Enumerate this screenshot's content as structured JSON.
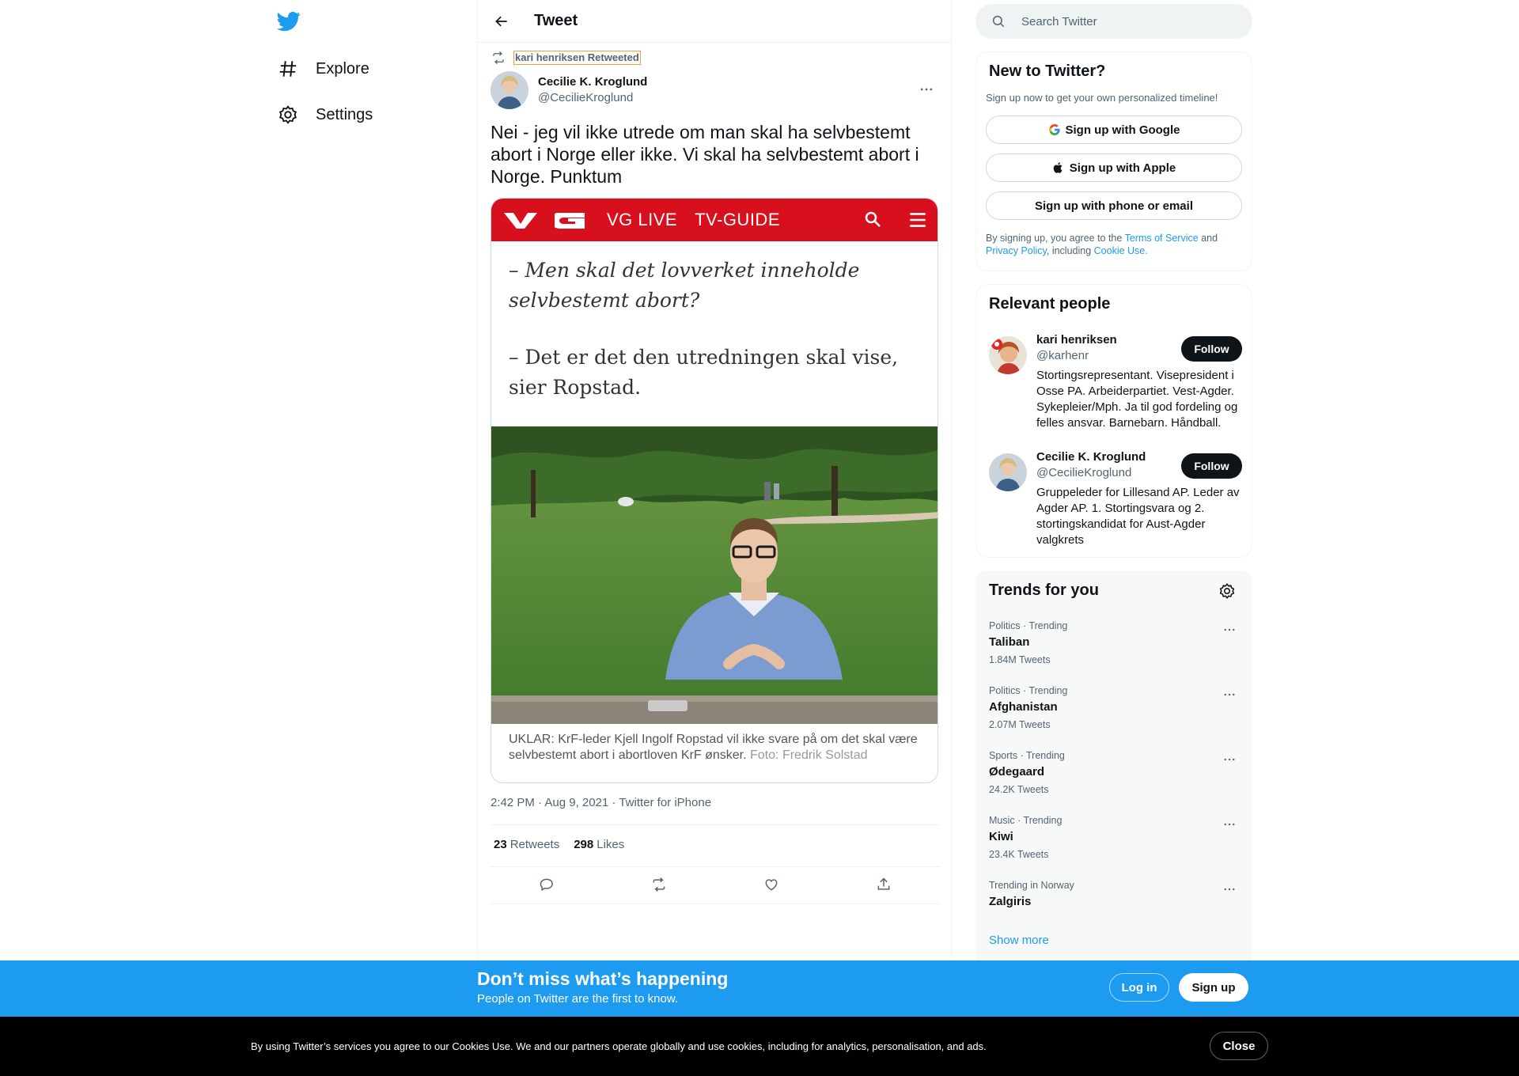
{
  "nav": {
    "logo": "twitter-bird-icon",
    "items": [
      {
        "icon": "hashtag-icon",
        "label": "Explore"
      },
      {
        "icon": "gear-icon",
        "label": "Settings"
      }
    ]
  },
  "header": {
    "title": "Tweet"
  },
  "tweet": {
    "retweeted_by": "kari henriksen Retweeted",
    "author_name": "Cecilie K. Kroglund",
    "author_handle": "@CecilieKroglund",
    "text": "Nei - jeg vil ikke utrede om man skal ha selvbestemt abort i Norge eller ikke. Vi skal ha selvbestemt abort i Norge. Punktum",
    "media": {
      "nav_links": [
        "VG LIVE",
        "TV-GUIDE"
      ],
      "quote_1": "– Men skal det lovverket inneholde selvbestemt abort?",
      "quote_2": "– Det er det den utredningen skal vise, sier Ropstad.",
      "caption": "UKLAR: KrF-leder Kjell Ingolf Ropstad vil ikke svare på om det skal være selvbestemt abort i abortloven KrF ønsker.",
      "caption_credit": "Foto: Fredrik Solstad"
    },
    "meta": "2:42 PM · Aug 9, 2021 · Twitter for iPhone",
    "retweets_count": "23",
    "retweets_label": "Retweets",
    "likes_count": "298",
    "likes_label": "Likes"
  },
  "search": {
    "placeholder": "Search Twitter"
  },
  "new_to_twitter": {
    "title": "New to Twitter?",
    "subtitle": "Sign up now to get your own personalized timeline!",
    "google": "Sign up with Google",
    "apple": "Sign up with Apple",
    "phone": "Sign up with phone or email",
    "terms_1": "By signing up, you agree to the ",
    "terms_link_1": "Terms of Service",
    "terms_2": " and ",
    "terms_link_2": "Privacy Policy",
    "terms_3": ", including ",
    "terms_link_3": "Cookie Use."
  },
  "relevant_people": {
    "title": "Relevant people",
    "follow_label": "Follow",
    "people": [
      {
        "name": "kari henriksen",
        "handle": "@karhenr",
        "bio": "Stortingsrepresentant. Visepresident i Osse PA. Arbeiderpartiet. Vest-Agder. Sykepleier/Mph. Ja til god fordeling og felles ansvar. Barnebarn. Håndball."
      },
      {
        "name": "Cecilie K. Kroglund",
        "handle": "@CecilieKroglund",
        "bio": "Gruppeleder for Lillesand AP. Leder av Agder AP. 1. Stortingsvara og 2. stortingskandidat for Aust-Agder valgkrets"
      }
    ]
  },
  "trends": {
    "title": "Trends for you",
    "items": [
      {
        "meta": "Politics · Trending",
        "name": "Taliban",
        "count": "1.84M Tweets"
      },
      {
        "meta": "Politics · Trending",
        "name": "Afghanistan",
        "count": "2.07M Tweets"
      },
      {
        "meta": "Sports · Trending",
        "name": "Ødegaard",
        "count": "24.2K Tweets"
      },
      {
        "meta": "Music · Trending",
        "name": "Kiwi",
        "count": "23.4K Tweets"
      },
      {
        "meta": "Trending in Norway",
        "name": "Zalgiris",
        "count": ""
      }
    ],
    "show_more": "Show more"
  },
  "promo": {
    "title": "Don’t miss what’s happening",
    "subtitle": "People on Twitter are the first to know.",
    "login": "Log in",
    "signup": "Sign up"
  },
  "cookie": {
    "text": "By using Twitter’s services you agree to our Cookies Use. We and our partners operate globally and use cookies, including for analytics, personalisation, and ads.",
    "close": "Close"
  },
  "colors": {
    "brand": "#1d9bf0",
    "vg_red": "#d80f1c",
    "text_primary": "#0f1419",
    "text_secondary": "#536471"
  }
}
